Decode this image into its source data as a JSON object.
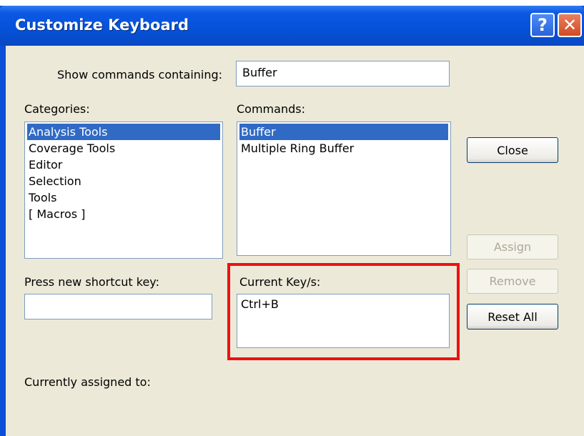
{
  "window": {
    "title": "Customize Keyboard",
    "help_label": "?",
    "close_label": "✕"
  },
  "search": {
    "label": "Show commands containing:",
    "value": "Buffer"
  },
  "categories": {
    "label": "Categories:",
    "items": [
      {
        "label": "Analysis Tools",
        "selected": true
      },
      {
        "label": "Coverage Tools",
        "selected": false
      },
      {
        "label": "Editor",
        "selected": false
      },
      {
        "label": "Selection",
        "selected": false
      },
      {
        "label": "Tools",
        "selected": false
      },
      {
        "label": "[ Macros ]",
        "selected": false
      }
    ]
  },
  "commands": {
    "label": "Commands:",
    "items": [
      {
        "label": "Buffer",
        "selected": true
      },
      {
        "label": "Multiple Ring Buffer",
        "selected": false
      }
    ]
  },
  "buttons": {
    "close": "Close",
    "assign": "Assign",
    "remove": "Remove",
    "reset_all": "Reset All"
  },
  "shortcut": {
    "label": "Press new shortcut key:",
    "value": ""
  },
  "current_keys": {
    "label": "Current Key/s:",
    "items": [
      "Ctrl+B"
    ]
  },
  "assigned": {
    "label": "Currently assigned to:"
  },
  "colors": {
    "highlight": "#ee1111",
    "selection": "#316ac5",
    "titlebar": "#0452d6"
  }
}
